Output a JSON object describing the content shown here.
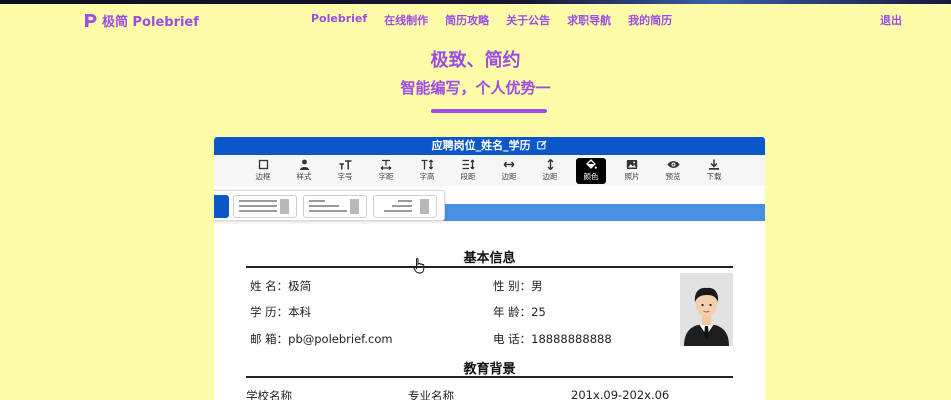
{
  "nav": {
    "logo_text": "极简 Polebrief",
    "menu": [
      "Polebrief",
      "在线制作",
      "简历攻略",
      "关于公告",
      "求职导航",
      "我的简历"
    ],
    "logout": "退出"
  },
  "hero": {
    "title": "极致、简约",
    "subtitle": "智能编写，个人优势一"
  },
  "resume_header": {
    "title": "应聘岗位_姓名_学历"
  },
  "toolbar": {
    "items": [
      {
        "label": "边框",
        "icon": "border-icon"
      },
      {
        "label": "样式",
        "icon": "person-icon"
      },
      {
        "label": "字号",
        "icon": "font-size-icon"
      },
      {
        "label": "字距",
        "icon": "letter-spacing-icon"
      },
      {
        "label": "字高",
        "icon": "line-height-icon"
      },
      {
        "label": "段距",
        "icon": "paragraph-spacing-icon"
      },
      {
        "label": "边距",
        "icon": "horizontal-margin-icon"
      },
      {
        "label": "边距",
        "icon": "vertical-margin-icon"
      },
      {
        "label": "颜色",
        "icon": "paint-bucket-icon"
      },
      {
        "label": "照片",
        "icon": "photo-icon"
      },
      {
        "label": "预览",
        "icon": "eye-icon"
      },
      {
        "label": "下载",
        "icon": "download-icon"
      }
    ],
    "active_label": "颜色"
  },
  "basic_info": {
    "title": "基本信息",
    "name": "姓 名：极简",
    "gender": "性 别：男",
    "education": "学 历：本科",
    "age": "年 龄：25",
    "email": "邮 箱：pb@polebrief.com",
    "phone": "电 话：18888888888"
  },
  "education": {
    "title": "教育背景",
    "school": "学校名称",
    "major": "专业名称",
    "period": "201x.09-202x.06"
  },
  "colors": {
    "background": "#fdfca8",
    "accent": "#9b4de6",
    "header_blue": "#0b56c8",
    "strip_blue": "#4a90e2"
  }
}
